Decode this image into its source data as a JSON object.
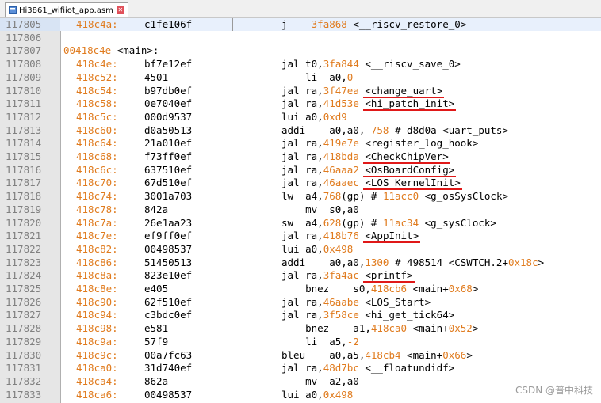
{
  "tab": {
    "title": "Hi3861_wifiiot_app.asm",
    "close_glyph": "✕"
  },
  "editor": {
    "label_line": {
      "number": "117807",
      "address": "00418c4e",
      "label": "<main>:"
    },
    "rows": [
      {
        "n": "117805",
        "addr": "418c4a:",
        "hex": "c1fe106f",
        "parts": [
          [
            "t",
            "j    "
          ],
          [
            "n",
            "3fa868"
          ],
          [
            "t",
            " <__riscv_restore_0>"
          ]
        ]
      },
      {
        "n": "117806",
        "addr": "",
        "hex": "",
        "parts": []
      },
      {
        "n": "117807",
        "addr": "",
        "hex": "",
        "parts": []
      },
      {
        "n": "117808",
        "addr": "418c4e:",
        "hex": "bf7e12ef",
        "parts": [
          [
            "t",
            "jal t0,"
          ],
          [
            "n",
            "3fa844"
          ],
          [
            "t",
            " <__riscv_save_0>"
          ]
        ]
      },
      {
        "n": "117809",
        "addr": "418c52:",
        "hex": "4501",
        "parts": [
          [
            "t",
            "    li  a0,"
          ],
          [
            "n",
            "0"
          ]
        ]
      },
      {
        "n": "117810",
        "addr": "418c54:",
        "hex": "b97db0ef",
        "parts": [
          [
            "t",
            "jal ra,"
          ],
          [
            "n",
            "3f47ea"
          ],
          [
            "t",
            " <change_uart>"
          ]
        ]
      },
      {
        "n": "117811",
        "addr": "418c58:",
        "hex": "0e7040ef",
        "parts": [
          [
            "t",
            "jal ra,"
          ],
          [
            "n",
            "41d53e"
          ],
          [
            "t",
            " <hi_patch_init>"
          ]
        ]
      },
      {
        "n": "117812",
        "addr": "418c5c:",
        "hex": "000d9537",
        "parts": [
          [
            "t",
            "lui a0,"
          ],
          [
            "n",
            "0xd9"
          ]
        ]
      },
      {
        "n": "117813",
        "addr": "418c60:",
        "hex": "d0a50513",
        "parts": [
          [
            "t",
            "addi    a0,a0,"
          ],
          [
            "n",
            "-758"
          ],
          [
            "t",
            " # d8d0a <uart_puts>"
          ]
        ]
      },
      {
        "n": "117814",
        "addr": "418c64:",
        "hex": "21a010ef",
        "parts": [
          [
            "t",
            "jal ra,"
          ],
          [
            "n",
            "419e7e"
          ],
          [
            "t",
            " <register_log_hook>"
          ]
        ]
      },
      {
        "n": "117815",
        "addr": "418c68:",
        "hex": "f73ff0ef",
        "parts": [
          [
            "t",
            "jal ra,"
          ],
          [
            "n",
            "418bda"
          ],
          [
            "t",
            " <CheckChipVer>"
          ]
        ]
      },
      {
        "n": "117816",
        "addr": "418c6c:",
        "hex": "637510ef",
        "parts": [
          [
            "t",
            "jal ra,"
          ],
          [
            "n",
            "46aaa2"
          ],
          [
            "t",
            " <OsBoardConfig>"
          ]
        ]
      },
      {
        "n": "117817",
        "addr": "418c70:",
        "hex": "67d510ef",
        "parts": [
          [
            "t",
            "jal ra,"
          ],
          [
            "n",
            "46aaec"
          ],
          [
            "t",
            " <LOS_KernelInit>"
          ]
        ]
      },
      {
        "n": "117818",
        "addr": "418c74:",
        "hex": "3001a703",
        "parts": [
          [
            "t",
            "lw  a4,"
          ],
          [
            "n",
            "768"
          ],
          [
            "t",
            "(gp) # "
          ],
          [
            "n",
            "11acc0"
          ],
          [
            "t",
            " <g_osSysClock>"
          ]
        ]
      },
      {
        "n": "117819",
        "addr": "418c78:",
        "hex": "842a",
        "parts": [
          [
            "t",
            "    mv  s0,a0"
          ]
        ]
      },
      {
        "n": "117820",
        "addr": "418c7a:",
        "hex": "26e1aa23",
        "parts": [
          [
            "t",
            "sw  a4,"
          ],
          [
            "n",
            "628"
          ],
          [
            "t",
            "(gp) # "
          ],
          [
            "n",
            "11ac34"
          ],
          [
            "t",
            " <g_sysClock>"
          ]
        ]
      },
      {
        "n": "117821",
        "addr": "418c7e:",
        "hex": "ef9ff0ef",
        "parts": [
          [
            "t",
            "jal ra,"
          ],
          [
            "n",
            "418b76"
          ],
          [
            "t",
            " <AppInit>"
          ]
        ]
      },
      {
        "n": "117822",
        "addr": "418c82:",
        "hex": "00498537",
        "parts": [
          [
            "t",
            "lui a0,"
          ],
          [
            "n",
            "0x498"
          ]
        ]
      },
      {
        "n": "117823",
        "addr": "418c86:",
        "hex": "51450513",
        "parts": [
          [
            "t",
            "addi    a0,a0,"
          ],
          [
            "n",
            "1300"
          ],
          [
            "t",
            " # 498514 <CSWTCH.2+"
          ],
          [
            "n",
            "0x18c"
          ],
          [
            "t",
            ">"
          ]
        ]
      },
      {
        "n": "117824",
        "addr": "418c8a:",
        "hex": "823e10ef",
        "parts": [
          [
            "t",
            "jal ra,"
          ],
          [
            "n",
            "3fa4ac"
          ],
          [
            "t",
            " <printf>"
          ]
        ]
      },
      {
        "n": "117825",
        "addr": "418c8e:",
        "hex": "e405",
        "parts": [
          [
            "t",
            "    bnez    s0,"
          ],
          [
            "n",
            "418cb6"
          ],
          [
            "t",
            " <main+"
          ],
          [
            "n",
            "0x68"
          ],
          [
            "t",
            ">"
          ]
        ]
      },
      {
        "n": "117826",
        "addr": "418c90:",
        "hex": "62f510ef",
        "parts": [
          [
            "t",
            "jal ra,"
          ],
          [
            "n",
            "46aabe"
          ],
          [
            "t",
            " <LOS_Start>"
          ]
        ]
      },
      {
        "n": "117827",
        "addr": "418c94:",
        "hex": "c3bdc0ef",
        "parts": [
          [
            "t",
            "jal ra,"
          ],
          [
            "n",
            "3f58ce"
          ],
          [
            "t",
            " <hi_get_tick64>"
          ]
        ]
      },
      {
        "n": "117828",
        "addr": "418c98:",
        "hex": "e581",
        "parts": [
          [
            "t",
            "    bnez    a1,"
          ],
          [
            "n",
            "418ca0"
          ],
          [
            "t",
            " <main+"
          ],
          [
            "n",
            "0x52"
          ],
          [
            "t",
            ">"
          ]
        ]
      },
      {
        "n": "117829",
        "addr": "418c9a:",
        "hex": "57f9",
        "parts": [
          [
            "t",
            "    li  a5,"
          ],
          [
            "n",
            "-2"
          ]
        ]
      },
      {
        "n": "117830",
        "addr": "418c9c:",
        "hex": "00a7fc63",
        "parts": [
          [
            "t",
            "bleu    a0,a5,"
          ],
          [
            "n",
            "418cb4"
          ],
          [
            "t",
            " <main+"
          ],
          [
            "n",
            "0x66"
          ],
          [
            "t",
            ">"
          ]
        ]
      },
      {
        "n": "117831",
        "addr": "418ca0:",
        "hex": "31d740ef",
        "parts": [
          [
            "t",
            "jal ra,"
          ],
          [
            "n",
            "48d7bc"
          ],
          [
            "t",
            " <__floatundidf>"
          ]
        ]
      },
      {
        "n": "117832",
        "addr": "418ca4:",
        "hex": "862a",
        "parts": [
          [
            "t",
            "    mv  a2,a0"
          ]
        ]
      },
      {
        "n": "117833",
        "addr": "418ca6:",
        "hex": "00498537",
        "parts": [
          [
            "t",
            "lui a0,"
          ],
          [
            "n",
            "0x498"
          ]
        ]
      }
    ]
  },
  "watermark": "CSDN @普中科技",
  "colors": {
    "line_number": "#808080",
    "address": "#e07b1e",
    "underline": "#e01818"
  }
}
